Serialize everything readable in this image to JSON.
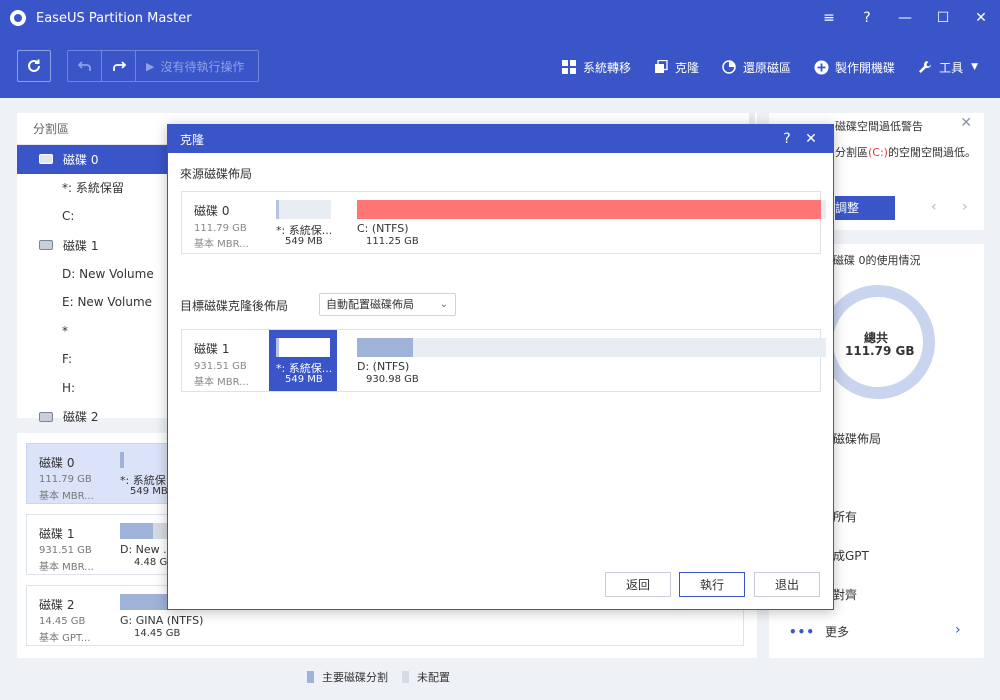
{
  "window": {
    "title": "EaseUS Partition Master",
    "controls": [
      "≡",
      "?",
      "—",
      "☐",
      "✕"
    ]
  },
  "toolbar": {
    "pending_label": "沒有待執行操作",
    "items": [
      {
        "label": "系統轉移",
        "icon": "grid-icon"
      },
      {
        "label": "克隆",
        "icon": "clone-icon"
      },
      {
        "label": "還原磁區",
        "icon": "pie-icon"
      },
      {
        "label": "製作開機碟",
        "icon": "plus-circle-icon"
      },
      {
        "label": "工具",
        "icon": "wrench-icon",
        "dropdown": true
      }
    ]
  },
  "partition_panel": {
    "header": "分割區",
    "rows": [
      {
        "label": "磁碟 0",
        "kind": "disk",
        "selected": true
      },
      {
        "label": "*: 系統保留",
        "kind": "part"
      },
      {
        "label": "C:",
        "kind": "part"
      },
      {
        "label": "磁碟 1",
        "kind": "disk"
      },
      {
        "label": "D: New Volume",
        "kind": "part"
      },
      {
        "label": "E: New Volume",
        "kind": "part"
      },
      {
        "label": "*",
        "kind": "part"
      },
      {
        "label": "F:",
        "kind": "part"
      },
      {
        "label": "H:",
        "kind": "part"
      },
      {
        "label": "磁碟 2",
        "kind": "disk"
      }
    ]
  },
  "disk_map": {
    "cards": [
      {
        "name": "磁碟 0",
        "size": "111.79 GB",
        "type": "基本 MBR...",
        "part_label": "*: 系統保",
        "part_size": "549 MB",
        "selected": true
      },
      {
        "name": "磁碟 1",
        "size": "931.51 GB",
        "type": "基本 MBR...",
        "part_label": "D: New ...",
        "part_size": "4.48 GB"
      },
      {
        "name": "磁碟 2",
        "size": "14.45 GB",
        "type": "基本 GPT...",
        "part_label": "G: GINA (NTFS)",
        "part_size": "14.45 GB"
      }
    ],
    "legend": [
      {
        "label": "主要磁碟分割",
        "color": "#9fb3d9"
      },
      {
        "label": "未配置",
        "color": "#d6dbe3"
      }
    ]
  },
  "right_panel": {
    "warning_title": "磁碟空間過低警告",
    "warning_text_pre": "分割區",
    "warning_text_drive": "(C:)",
    "warning_text_post": "的空閒空間過低。",
    "adjust_button": "調整",
    "usage_title": "磁碟 0的使用情況",
    "ring_label": "總共",
    "ring_value": "111.79 GB",
    "items": [
      "磁碟佈局",
      "所有",
      "成GPT",
      "對齊"
    ],
    "more": "更多"
  },
  "dialog": {
    "title": "克隆",
    "title_controls": [
      "?",
      "✕"
    ],
    "source_label": "來源磁碟佈局",
    "target_label": "目標磁碟克隆後佈局",
    "layout_option": "自動配置磁碟佈局",
    "source": {
      "name": "磁碟 0",
      "size": "111.79 GB",
      "type": "基本 MBR...",
      "parts": [
        {
          "label": "*: 系統保...",
          "size": "549 MB",
          "fill": 1.0,
          "color": "#b7c4e0"
        },
        {
          "label": "C: (NTFS)",
          "size": "111.25 GB",
          "fill": 0.99,
          "color": "#ff7474"
        }
      ]
    },
    "target": {
      "name": "磁碟 1",
      "size": "931.51 GB",
      "type": "基本 MBR...",
      "parts": [
        {
          "label": "*: 系統保...",
          "size": "549 MB",
          "fill": 1.0,
          "color": "#ffffff"
        },
        {
          "label": "D: (NTFS)",
          "size": "930.98 GB",
          "fill": 0.12,
          "color": "#9fb3d9"
        }
      ]
    },
    "buttons": {
      "back": "返回",
      "execute": "執行",
      "exit": "退出"
    }
  }
}
